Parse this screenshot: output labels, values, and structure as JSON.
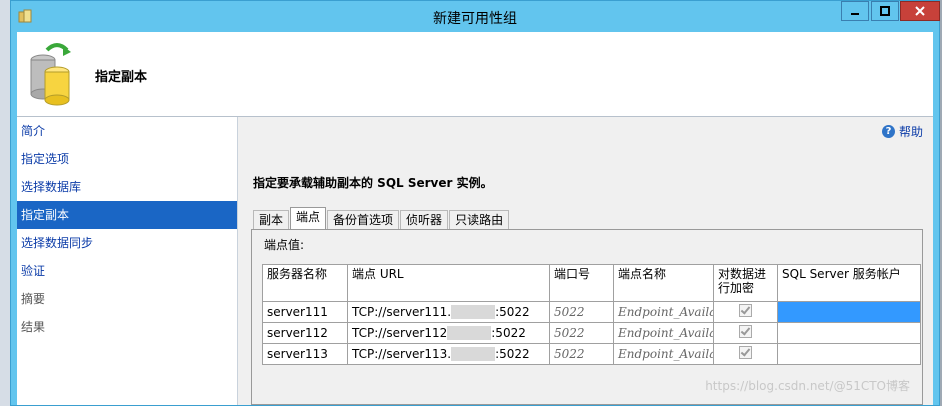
{
  "window": {
    "title": "新建可用性组"
  },
  "header": {
    "title": "指定副本"
  },
  "sidebar": {
    "items": [
      {
        "label": "简介"
      },
      {
        "label": "指定选项"
      },
      {
        "label": "选择数据库"
      },
      {
        "label": "指定副本"
      },
      {
        "label": "选择数据同步"
      },
      {
        "label": "验证"
      },
      {
        "label": "摘要"
      },
      {
        "label": "结果"
      }
    ]
  },
  "help": {
    "label": "帮助"
  },
  "main": {
    "instruction": "指定要承载辅助副本的 SQL Server 实例。",
    "tabs": [
      {
        "label": "副本"
      },
      {
        "label": "端点"
      },
      {
        "label": "备份首选项"
      },
      {
        "label": "侦听器"
      },
      {
        "label": "只读路由"
      }
    ],
    "endpoint_label": "端点值:"
  },
  "table": {
    "headers": [
      "服务器名称",
      "端点 URL",
      "端口号",
      "端点名称",
      "对数据进行加密",
      "SQL Server 服务帐户"
    ],
    "rows": [
      {
        "server": "server111",
        "url_prefix": "TCP://server111.",
        "url_suffix": ":5022",
        "port": "5022",
        "endpoint": "Endpoint_Availab"
      },
      {
        "server": "server112",
        "url_prefix": "TCP://server112",
        "url_suffix": ":5022",
        "port": "5022",
        "endpoint": "Endpoint_Availab"
      },
      {
        "server": "server113",
        "url_prefix": "TCP://server113.",
        "url_suffix": ":5022",
        "port": "5022",
        "endpoint": "Endpoint_Availab"
      }
    ]
  },
  "watermark": "https://blog.csdn.net/@51CTO博客",
  "colors": {
    "titlebar": "#62c5ee",
    "selected": "#1a66c5",
    "close": "#c7413a"
  }
}
